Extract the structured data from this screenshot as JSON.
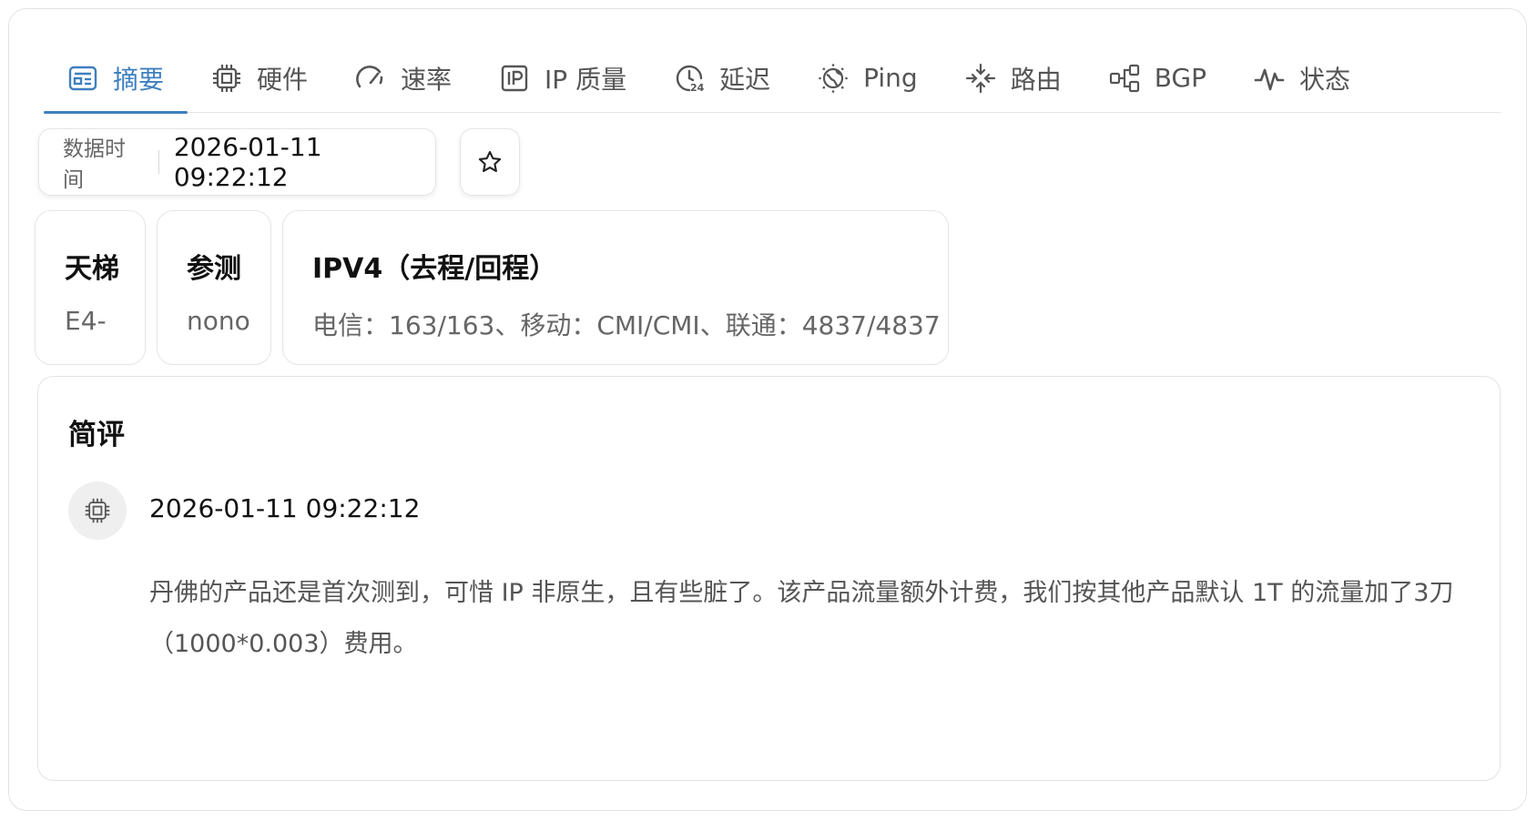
{
  "tabs": [
    {
      "label": "摘要",
      "icon": "summary-icon",
      "active": true
    },
    {
      "label": "硬件",
      "icon": "chip-icon"
    },
    {
      "label": "速率",
      "icon": "gauge-icon"
    },
    {
      "label": "IP 质量",
      "icon": "ip-icon"
    },
    {
      "label": "延迟",
      "icon": "clock-24-icon"
    },
    {
      "label": "Ping",
      "icon": "globe-icon"
    },
    {
      "label": "路由",
      "icon": "route-arrows-icon"
    },
    {
      "label": "BGP",
      "icon": "network-nodes-icon"
    },
    {
      "label": "状态",
      "icon": "pulse-icon"
    }
  ],
  "colors": {
    "accent": "#3f7fbf",
    "border": "#e5e5e5",
    "muted": "#666666"
  },
  "data_time": {
    "label": "数据时间",
    "value": "2026-01-11 09:22:12"
  },
  "star_icon": "star-icon",
  "cards": {
    "ladder": {
      "title": "天梯",
      "value": "E4-"
    },
    "tester": {
      "title": "参测",
      "value": "nono"
    },
    "ipv4": {
      "title": "IPV4（去程/回程）",
      "value": "电信：163/163、移动：CMI/CMI、联通：4837/4837"
    }
  },
  "review": {
    "title": "简评",
    "avatar_icon": "chip-icon",
    "time": "2026-01-11 09:22:12",
    "body": "丹佛的产品还是首次测到，可惜 IP 非原生，且有些脏了。该产品流量额外计费，我们按其他产品默认 1T 的流量加了3刀（1000*0.003）费用。"
  }
}
